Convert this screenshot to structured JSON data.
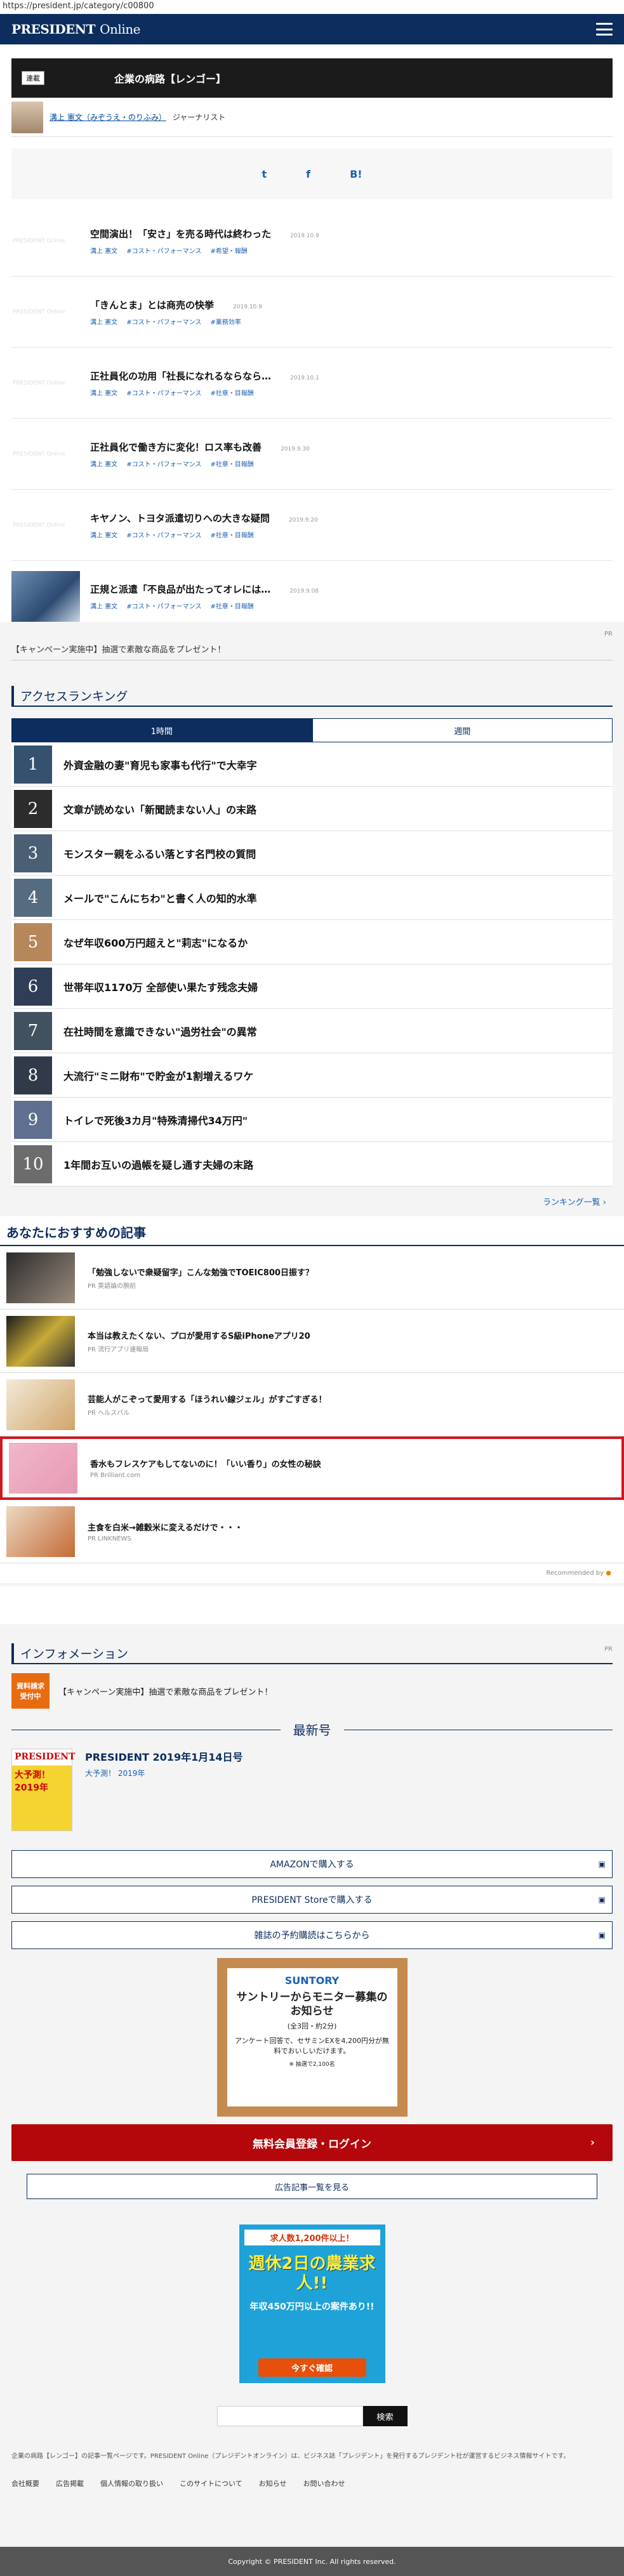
{
  "browser": {
    "url": "https://president.jp/category/c00800"
  },
  "header": {
    "logo_main": "PRESIDENT",
    "logo_sub": "Online"
  },
  "series": {
    "tag": "連載",
    "title": "企業の病路【レンゴー】"
  },
  "author": {
    "name": "溝上 憲文（みぞうえ・のりふみ）",
    "role": "ジャーナリスト"
  },
  "share": [
    "t",
    "f",
    "B!"
  ],
  "articles": [
    {
      "title": "空間演出！「安さ」を売る時代は終わった",
      "date": "2019.10.9",
      "tags": [
        "溝上 憲文",
        "#コスト・パフォーマンス",
        "#希望・報酬"
      ],
      "thumb": "PRESIDENT Online"
    },
    {
      "title": "「きんとま」とは商売の快挙",
      "date": "2019.10.9",
      "tags": [
        "溝上 憲文",
        "#コスト・パフォーマンス",
        "#業務効率"
      ],
      "thumb": "PRESIDENT Online"
    },
    {
      "title": "正社員化の功用「社長になれるならなら…",
      "date": "2019.10.1",
      "tags": [
        "溝上 憲文",
        "#コスト・パフォーマンス",
        "#社章・目報酬"
      ],
      "thumb": "PRESIDENT Online"
    },
    {
      "title": "正社員化で働き方に変化！ロス率も改善",
      "date": "2019.9.30",
      "tags": [
        "溝上 憲文",
        "#コスト・パフォーマンス",
        "#社章・目報酬"
      ],
      "thumb": "PRESIDENT Online"
    },
    {
      "title": "キヤノン、トヨタ派遣切りへの大きな疑問",
      "date": "2019.9.20",
      "tags": [
        "溝上 憲文",
        "#コスト・パフォーマンス",
        "#社章・目報酬"
      ],
      "thumb": "PRESIDENT Online"
    },
    {
      "title": "正規と派遣「不良品が出たってオレには…",
      "date": "2019.9.08",
      "tags": [
        "溝上 憲文",
        "#コスト・パフォーマンス",
        "#社章・目報酬"
      ],
      "thumb": ""
    }
  ],
  "pr_label": "PR",
  "campaign": "【キャンペーン実施中】抽選で素敵な商品をプレゼント！",
  "ranking": {
    "heading": "アクセスランキング",
    "tab_hour": "1時間",
    "tab_week": "週間",
    "items": [
      "外資金融の妻\"育児も家事も代行\"で大幸字",
      "文章が読めない「新聞読まない人」の末路",
      "モンスター親をふるい落とす名門校の質問",
      "メールで\"こんにちわ\"と書く人の知的水準",
      "なぜ年収600万円超えと\"莉志\"になるか",
      "世帯年収1170万 全部使い果たす残念夫婦",
      "在社時間を意識できない\"過労社会\"の異常",
      "大流行\"ミニ財布\"で貯金が1割増えるワケ",
      "トイレで死後3カ月\"特殊清掃代34万円\"",
      "1年間お互いの過帳を疑し通す夫婦の末路"
    ],
    "more": "ランキング一覧 ›"
  },
  "recommend": {
    "heading": "あなたにおすすめの記事",
    "items": [
      {
        "title": "「勉強しないで衆疑留字」こんな勉強でTOEIC800日振す？",
        "src": "PR 英語論の腕前"
      },
      {
        "title": "本当は教えたくない、プロが愛用するS級iPhoneアプリ20",
        "src": "PR 流行アプリ速報局"
      },
      {
        "title": "芸能人がこぞって愛用する「ほうれい線ジェル」がすごすぎる！",
        "src": "PR ヘルスパル"
      },
      {
        "title": "香水もフレスケアもしてないのに！「いい香り」の女性の秘訣",
        "src": "PR Brilliant.com"
      },
      {
        "title": "主食を白米→雑穀米に変えるだけで・・・",
        "src": "PR LINKNEWS"
      }
    ],
    "recommended_by": "Recommended by"
  },
  "info": {
    "heading": "インフォメーション",
    "badge": "資料請求受付中",
    "campaign": "【キャンペーン実施中】抽選で素敵な商品をプレゼント！"
  },
  "latest": {
    "heading": "最新号",
    "issue_title": "PRESIDENT 2019年1月14日号",
    "issue_sub": "大予測！ 2019年",
    "cover_title": "大予測！2019年",
    "buttons": [
      "AMAZONで購入する",
      "PRESIDENT Storeで購入する",
      "雑誌の予約購読はこちらから"
    ]
  },
  "ad1": {
    "brand": "SUNTORY",
    "headline": "サントリーからモニター募集のお知らせ",
    "note": "(全3回・約2分)",
    "body": "アンケート回答で、セサミンEXを4,200円分が無料でおいしいだけます。",
    "foot": "※ 抽選で2,100名"
  },
  "register": "無料会員登録・ログイン",
  "ad_list": "広告記事一覧を見る",
  "ad2": {
    "top": "求人数1,200件以上！",
    "mid": "週休2日の農業求人!!",
    "sub": "年収450万円以上の案件あり!!",
    "cta": "今すぐ確認"
  },
  "search": {
    "placeholder": "",
    "button": "検索"
  },
  "about": "企業の病路【レンゴー】の記事一覧ページです。PRESIDENT Online（プレジデントオンライン）は、ビジネス誌「プレジデント」を発行するプレジデント社が運営するビジネス情報サイトです。",
  "footer_links": [
    "会社概要",
    "広告掲載",
    "個人情報の取り扱い",
    "このサイトについて",
    "お知らせ",
    "お問い合わせ"
  ],
  "copyright": "Copyright © PRESIDENT Inc. All rights reserved.",
  "colors": {
    "navy": "#0c2d5e",
    "red": "#b4070b",
    "highlight": "#d0191e"
  }
}
